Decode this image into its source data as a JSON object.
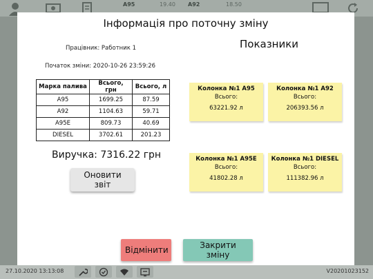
{
  "background": {
    "topbar": {
      "fuels": [
        {
          "name": "A95",
          "price": "19.40"
        },
        {
          "name": "A92",
          "price": "18.50"
        }
      ]
    },
    "bottombar": {
      "datetime": "27.10.2020 13:13:08",
      "version": "V20201023152"
    }
  },
  "modal": {
    "title": "Інформація про поточну зміну",
    "worker": "Працівник: Работник 1",
    "shift_start": "Початок зміни: 2020-10-26 23:59:26",
    "table": {
      "headers": [
        "Марка палива",
        "Всього, грн",
        "Всього, л"
      ],
      "rows": [
        [
          "A95",
          "1699.25",
          "87.59"
        ],
        [
          "A92",
          "1104.63",
          "59.71"
        ],
        [
          "A95E",
          "809.73",
          "40.69"
        ],
        [
          "DIESEL",
          "3702.61",
          "201.23"
        ]
      ]
    },
    "revenue": "Виручка: 7316.22 грн",
    "refresh_label": "Оновити звіт",
    "indicators_title": "Показники",
    "cards": [
      {
        "name": "Колонка №1 A95",
        "total_label": "Всього:",
        "value": "63221.92 л"
      },
      {
        "name": "Колонка №1 A92",
        "total_label": "Всього:",
        "value": "206393.56 л"
      },
      {
        "name": "Колонка №1 A95E",
        "total_label": "Всього:",
        "value": "41802.28 л"
      },
      {
        "name": "Колонка №1 DIESEL",
        "total_label": "Всього:",
        "value": "111382.96 л"
      }
    ],
    "cancel_label": "Відмінити",
    "close_shift_label": "Закрити зміну"
  }
}
